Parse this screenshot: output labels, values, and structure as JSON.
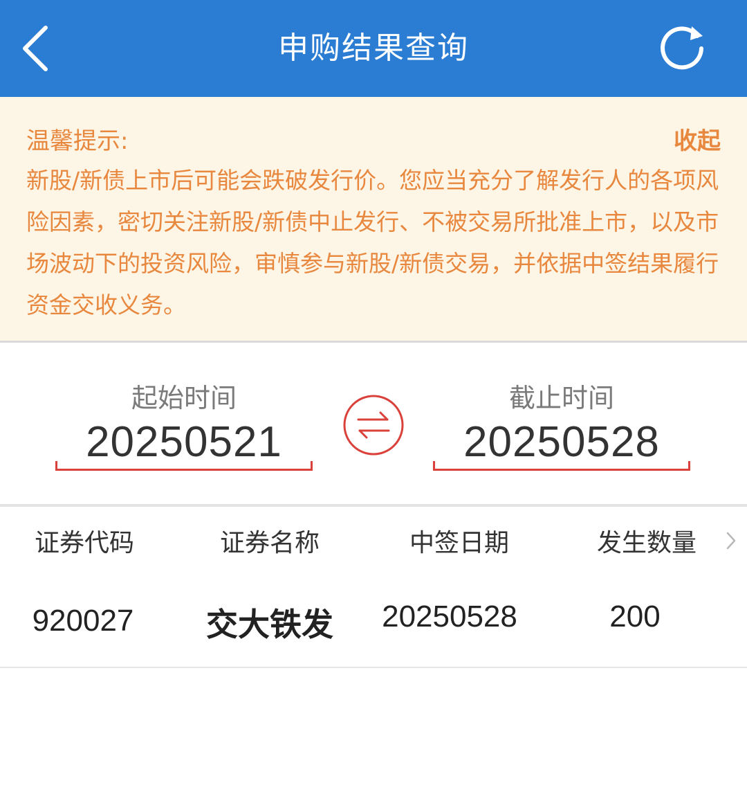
{
  "header": {
    "title": "申购结果查询",
    "icons": {
      "back": "chevron-left-icon",
      "refresh": "refresh-icon"
    },
    "colors": {
      "background": "#2b7cd3",
      "text": "#ffffff"
    }
  },
  "tip": {
    "title": "温馨提示:",
    "collapse_label": "收起",
    "body": "新股/新债上市后可能会跌破发行价。您应当充分了解发行人的各项风险因素，密切关注新股/新债中止发行、不被交易所批准上市，以及市场波动下的投资风险，审慎参与新股/新债交易，并依据中签结果履行资金交收义务。",
    "colors": {
      "background": "#fdf5e5",
      "text": "#e8873e"
    }
  },
  "date_range": {
    "start_label": "起始时间",
    "start_value": "20250521",
    "end_label": "截止时间",
    "end_value": "20250528",
    "swap_icon": "swap-arrows-icon",
    "accent_color": "#d9413a"
  },
  "table": {
    "headers": [
      "证券代码",
      "证券名称",
      "中签日期",
      "发生数量"
    ],
    "more_icon": "chevron-right-icon",
    "rows": [
      {
        "code": "920027",
        "name": "交大铁发",
        "date": "20250528",
        "quantity": "200"
      }
    ]
  }
}
